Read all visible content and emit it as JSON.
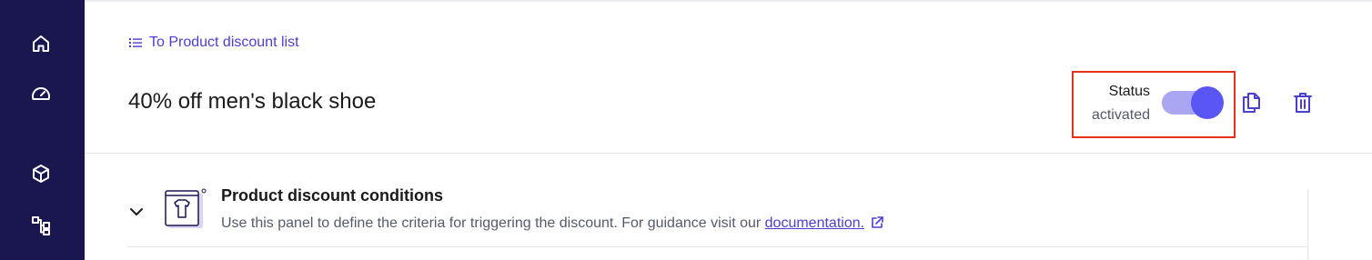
{
  "sidebar": {
    "items": [
      {
        "icon": "home-icon"
      },
      {
        "icon": "dashboard-gauge-icon"
      },
      {
        "icon": "cube-icon"
      },
      {
        "icon": "hierarchy-icon"
      }
    ]
  },
  "header": {
    "back_link": "To Product discount list",
    "title": "40% off men's black shoe"
  },
  "status": {
    "label": "Status",
    "value": "activated",
    "enabled": true
  },
  "panel": {
    "title": "Product discount conditions",
    "description": "Use this panel to define the criteria for triggering the discount. For guidance visit our ",
    "link_text": "documentation."
  },
  "colors": {
    "sidebar_bg": "#1a1650",
    "accent": "#4b3fd0",
    "toggle_knob": "#5a55f5",
    "toggle_track": "#aaa6f2",
    "highlight_border": "#e8301c"
  }
}
